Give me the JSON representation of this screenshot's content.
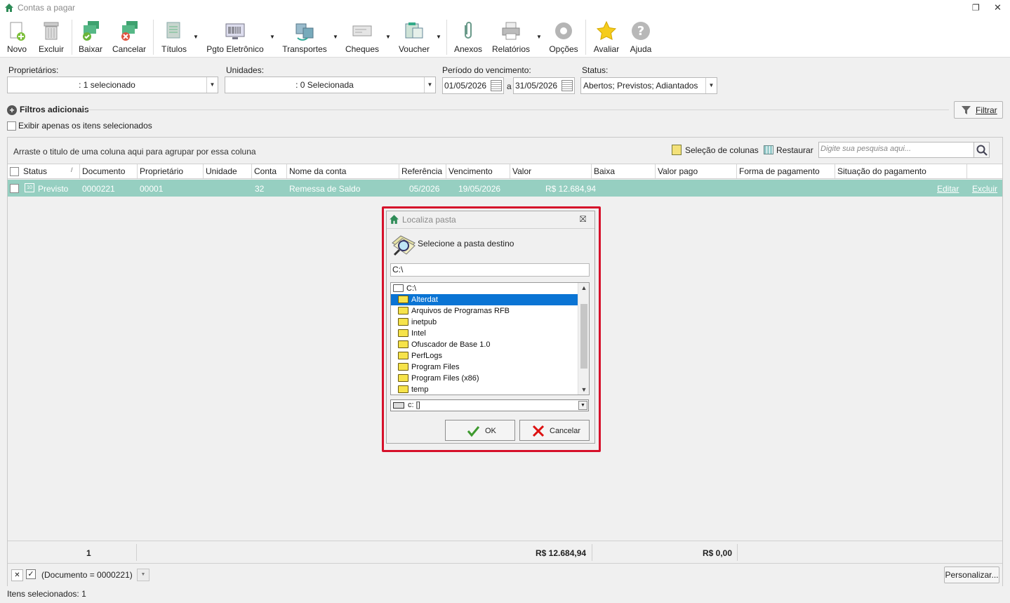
{
  "window": {
    "title": "Contas a pagar"
  },
  "toolbar": {
    "buttons": [
      {
        "label": "Novo"
      },
      {
        "label": "Excluir"
      },
      {
        "label": "Baixar"
      },
      {
        "label": "Cancelar"
      },
      {
        "label": "Títulos"
      },
      {
        "label": "Pgto Eletrônico"
      },
      {
        "label": "Transportes"
      },
      {
        "label": "Cheques"
      },
      {
        "label": "Voucher"
      },
      {
        "label": "Anexos"
      },
      {
        "label": "Relatórios"
      },
      {
        "label": "Opções"
      },
      {
        "label": "Avaliar"
      },
      {
        "label": "Ajuda"
      }
    ]
  },
  "filters": {
    "proprietarios_label": "Proprietários:",
    "proprietarios_value": ": 1 selecionado",
    "unidades_label": "Unidades:",
    "unidades_value": ": 0 Selecionada",
    "periodo_label": "Período do vencimento:",
    "date_from": "01/05/2026",
    "date_sep": "a",
    "date_to": "31/05/2026",
    "status_label": "Status:",
    "status_value": "Abertos; Previstos; Adiantados",
    "filtros_adicionais": "Filtros adicionais",
    "filtrar_label": "Filtrar",
    "exibir_apenas": "Exibir apenas os itens selecionados"
  },
  "grid": {
    "group_hint": "Arraste o titulo de uma coluna aqui para agrupar por essa coluna",
    "selecao_colunas": "Seleção de colunas",
    "restaurar": "Restaurar",
    "search_placeholder": "Digite sua pesquisa aqui...",
    "columns": [
      "Status",
      "Documento",
      "Proprietário",
      "Unidade",
      "Conta",
      "Nome da conta",
      "Referência",
      "Vencimento",
      "Valor",
      "Baixa",
      "Valor pago",
      "Forma de pagamento",
      "Situação do pagamento"
    ],
    "rows": [
      {
        "status": "Previsto",
        "documento": "0000221",
        "proprietario": "00001",
        "unidade": "",
        "conta": "32",
        "nome_conta": "Remessa de Saldo",
        "referencia": "05/2026",
        "vencimento": "19/05/2026",
        "valor": "R$ 12.684,94",
        "editar": "Editar",
        "excluir": "Excluir"
      }
    ],
    "footer": {
      "count": "1",
      "valor_total": "R$ 12.684,94",
      "valor_pago_total": "R$ 0,00"
    },
    "filter_expression": "(Documento = 0000221)",
    "personalizar": "Personalizar..."
  },
  "status_bar": {
    "text": "Itens selecionados: 1"
  },
  "dialog": {
    "title": "Localiza pasta",
    "prompt": "Selecione a pasta destino",
    "path": "C:\\",
    "tree": [
      {
        "label": "C:\\",
        "selected": false
      },
      {
        "label": "Alterdat",
        "selected": true
      },
      {
        "label": "Arquivos de Programas RFB",
        "selected": false
      },
      {
        "label": "inetpub",
        "selected": false
      },
      {
        "label": "Intel",
        "selected": false
      },
      {
        "label": "Ofuscador de Base 1.0",
        "selected": false
      },
      {
        "label": "PerfLogs",
        "selected": false
      },
      {
        "label": "Program Files",
        "selected": false
      },
      {
        "label": "Program Files (x86)",
        "selected": false
      },
      {
        "label": "temp",
        "selected": false
      }
    ],
    "drive": "c: []",
    "ok_label": "OK",
    "cancel_label": "Cancelar"
  },
  "colors": {
    "selected_row": "#96cfc1",
    "tree_selection": "#0a74d4",
    "highlight_outline": "#d6102a"
  }
}
